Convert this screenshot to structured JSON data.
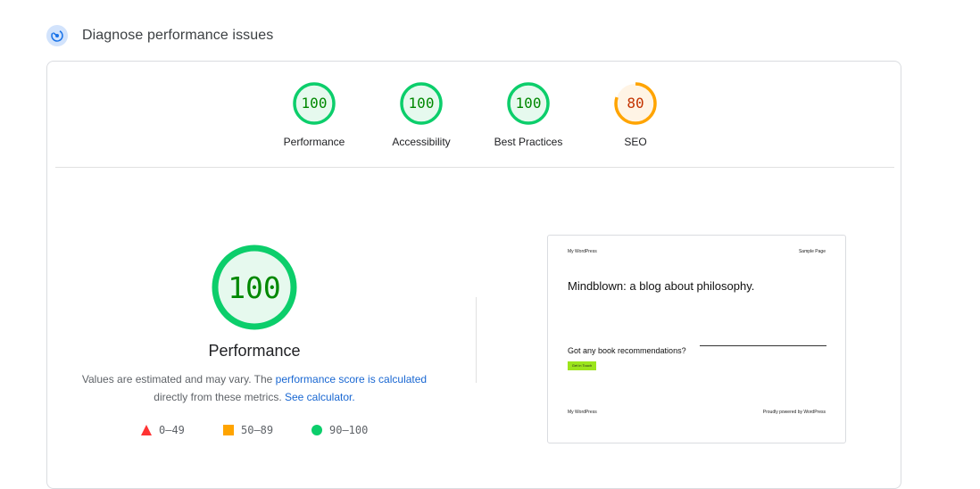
{
  "header": {
    "title": "Diagnose performance issues",
    "icon": "speed-dial-icon"
  },
  "colors": {
    "pass": "#0cce6b",
    "pass_text": "#008800",
    "pass_fill": "#e6f9ee",
    "average": "#ffa400",
    "average_text": "#c33300",
    "average_fill": "#fff4e5",
    "fail": "#ff3333",
    "link": "#1967d2"
  },
  "scores": [
    {
      "label": "Performance",
      "value": 100,
      "display": "100"
    },
    {
      "label": "Accessibility",
      "value": 100,
      "display": "100"
    },
    {
      "label": "Best Practices",
      "value": 100,
      "display": "100"
    },
    {
      "label": "SEO",
      "value": 80,
      "display": "80"
    }
  ],
  "performance": {
    "score": 100,
    "score_display": "100",
    "title": "Performance",
    "desc_prefix": "Values are estimated and may vary. The ",
    "desc_link1": "performance score is calculated",
    "desc_middle": " directly from these metrics. ",
    "desc_link2": "See calculator."
  },
  "legend": [
    {
      "shape": "triangle",
      "range": "0–49"
    },
    {
      "shape": "square",
      "range": "50–89"
    },
    {
      "shape": "circle",
      "range": "90–100"
    }
  ],
  "preview": {
    "site_name": "My WordPress",
    "nav_link": "Sample Page",
    "headline": "Mindblown: a blog about philosophy.",
    "question": "Got any book recommendations?",
    "button": "Get in Touch",
    "footer_left": "My WordPress",
    "footer_right": "Proudly powered by WordPress"
  }
}
